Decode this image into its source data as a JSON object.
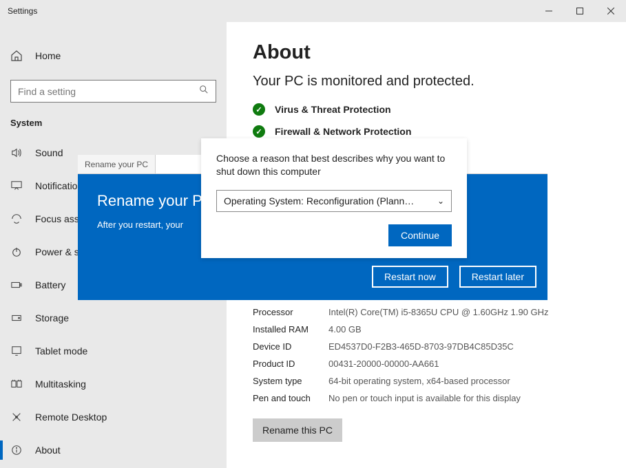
{
  "window": {
    "title": "Settings"
  },
  "sidebar": {
    "home": "Home",
    "search_placeholder": "Find a setting",
    "section": "System",
    "items": [
      {
        "label": "Sound"
      },
      {
        "label": "Notifications"
      },
      {
        "label": "Focus assist"
      },
      {
        "label": "Power & sleep"
      },
      {
        "label": "Battery"
      },
      {
        "label": "Storage"
      },
      {
        "label": "Tablet mode"
      },
      {
        "label": "Multitasking"
      },
      {
        "label": "Remote Desktop"
      },
      {
        "label": "About"
      }
    ]
  },
  "about": {
    "title": "About",
    "subtitle": "Your PC is monitored and protected.",
    "protections": [
      "Virus & Threat Protection",
      "Firewall & Network Protection"
    ],
    "specs": {
      "Processor": "Intel(R) Core(TM) i5-8365U CPU @ 1.60GHz   1.90 GHz",
      "Installed RAM": "4.00 GB",
      "Device ID": "ED4537D0-F2B3-465D-8703-97DB4C85D35C",
      "Product ID": "00431-20000-00000-AA661",
      "System type": "64-bit operating system, x64-based processor",
      "Pen and touch": "No pen or touch input is available for this display"
    },
    "rename_button": "Rename this PC"
  },
  "rename_modal": {
    "tab": "Rename your PC",
    "title": "Rename your PC",
    "text_partial": "After you restart, your",
    "restart_now": "Restart now",
    "restart_later": "Restart later"
  },
  "shutdown_popup": {
    "prompt": "Choose a reason that best describes why you want to shut down this computer",
    "selected": "Operating System: Reconfiguration (Plann…",
    "continue": "Continue"
  }
}
